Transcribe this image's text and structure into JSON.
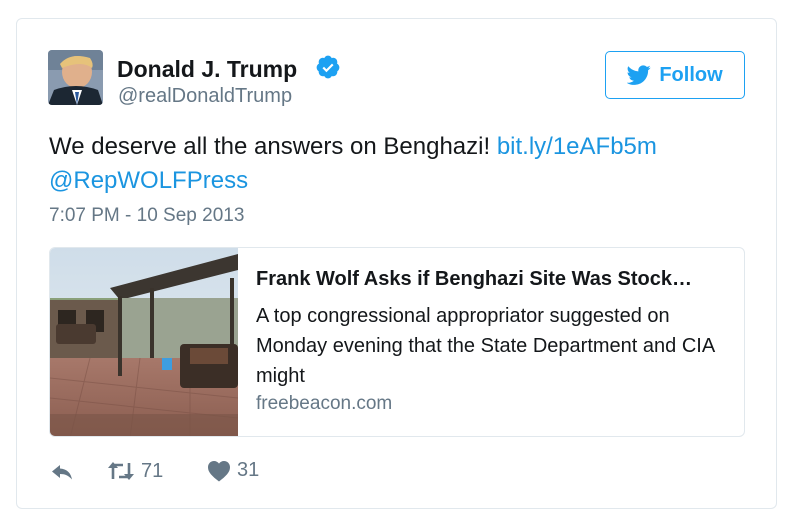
{
  "tweet": {
    "author": {
      "display_name": "Donald J. Trump",
      "handle": "@realDonaldTrump",
      "verified": true
    },
    "follow_label": "Follow",
    "text_prefix": "We deserve all the answers on Benghazi! ",
    "link_text": "bit.ly/1eAFb5m",
    "mention_text": "@RepWOLFPress",
    "timestamp": "7:07 PM - 10 Sep 2013",
    "card": {
      "title": "Frank Wolf Asks if Benghazi Site Was Stock…",
      "description": "A top congressional appropriator suggested on Monday evening that the State Department and CIA might",
      "domain": "freebeacon.com"
    },
    "actions": {
      "retweet_count": "71",
      "like_count": "31"
    }
  },
  "colors": {
    "accent": "#1da1f2",
    "link": "#1b95e0",
    "muted": "#657786",
    "border": "#e1e8ed"
  },
  "icons": [
    "verified-badge-icon",
    "twitter-bird-icon",
    "reply-icon",
    "retweet-icon",
    "heart-icon"
  ]
}
